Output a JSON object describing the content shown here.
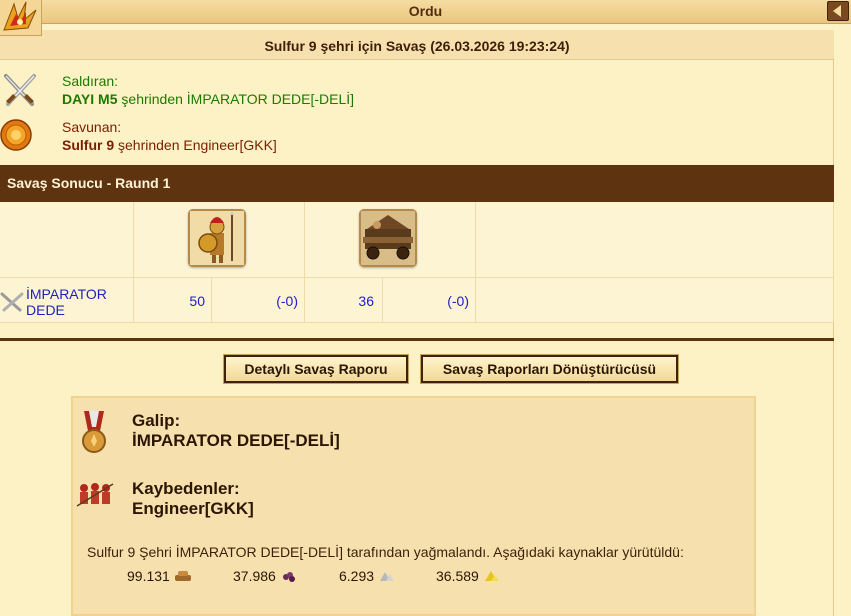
{
  "window": {
    "title": "Ordu"
  },
  "report": {
    "title": "Sulfur 9 şehri için Savaş (26.03.2026 19:23:24)"
  },
  "attacker": {
    "label": "Saldıran:",
    "city": "DAYI M5",
    "connector": " şehrinden ",
    "player": "İMPARATOR DEDE[-DELİ]",
    "icon": "crossed-swords-icon"
  },
  "defender": {
    "label": "Savunan:",
    "city": "Sulfur 9",
    "connector": " şehrinden ",
    "player": "Engineer[GKK]",
    "icon": "shield-icon"
  },
  "result": {
    "header": "Savaş Sonucu - Raund 1",
    "row_player_line1": "İMPARATOR",
    "row_player_line2": "DEDE",
    "units": [
      {
        "icon": "hoplite-unit-icon",
        "count": "50",
        "loss": "(-0)"
      },
      {
        "icon": "battering-ram-unit-icon",
        "count": "36",
        "loss": "(-0)"
      }
    ]
  },
  "buttons": {
    "detailed_report": "Detaylı Savaş Raporu",
    "report_converter": "Savaş Raporları Dönüştürücüsü"
  },
  "summary": {
    "winner_label": "Galip:",
    "winner": "İMPARATOR DEDE[-DELİ]",
    "losers_label": "Kaybedenler:",
    "losers": "Engineer[GKK]",
    "plunder_text": "Sulfur 9 Şehri İMPARATOR DEDE[-DELİ] tarafından yağmalandı. Aşağıdaki kaynaklar yürütüldü:",
    "resources": [
      {
        "amount": "99.131",
        "icon": "wood-icon"
      },
      {
        "amount": "37.986",
        "icon": "wine-icon"
      },
      {
        "amount": "6.293",
        "icon": "marble-icon"
      },
      {
        "amount": "36.589",
        "icon": "sulfur-icon"
      }
    ]
  },
  "colors": {
    "header_brown": "#5e3410",
    "panel_bg": "#fdf1c6",
    "attacker_green": "#1d7a00",
    "defender_red": "#7a1e00",
    "link_blue": "#2020c8"
  }
}
